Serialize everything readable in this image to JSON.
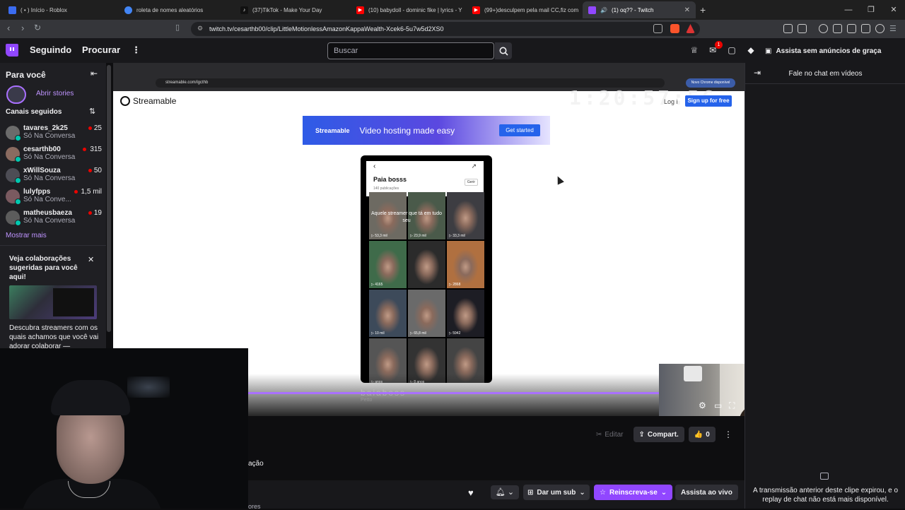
{
  "browser": {
    "tabs": [
      {
        "title": "( • ) Início - Roblox",
        "icon_color": "#3b6cf0"
      },
      {
        "title": "roleta de nomes aleatórios",
        "icon_color": "#4285f4"
      },
      {
        "title": "(37)TikTok - Make Your Day",
        "icon_color": "#111111"
      },
      {
        "title": "(10) babydoll - dominic fike | lyrics - Y",
        "icon_color": "#ff0000"
      },
      {
        "title": "(99+)desculpem pela mail CC,fiz com",
        "icon_color": "#ff0000"
      },
      {
        "title": "(1) oq?? - Twitch",
        "icon_color": "#9147ff",
        "active": true
      }
    ],
    "url": "twitch.tv/cesarthb00/clip/LittleMotionlessAmazonKappaWealth-Xcek6-5u7w5d2XS0"
  },
  "twitch_nav": {
    "following": "Seguindo",
    "browse": "Procurar",
    "search_placeholder": "Buscar",
    "notifications_count": "1",
    "ad_free": "Assista sem anúncios de graça"
  },
  "sidebar": {
    "for_you": "Para você",
    "stories": "Abrir stories",
    "followed_title": "Canais seguidos",
    "channels": [
      {
        "name": "tavares_2k25",
        "game": "Só Na Conversa",
        "viewers": "25",
        "avatar": "#6b6b6b"
      },
      {
        "name": "cesarthb00",
        "game": "Só Na Conversa",
        "viewers": "315",
        "avatar": "#8a6b60"
      },
      {
        "name": "xWillSouza",
        "game": "Só Na Conversa",
        "viewers": "50",
        "avatar": "#4d4d55"
      },
      {
        "name": "lulyfpps",
        "game": "Só Na Conve...",
        "viewers": "1,5 mil",
        "avatar": "#7a5a60"
      },
      {
        "name": "matheusbaeza",
        "game": "Só Na Conversa",
        "viewers": "19",
        "avatar": "#5c5c5c"
      }
    ],
    "show_more": "Mostrar mais",
    "collab_title": "Veja colaborações sugeridas para você aqui!",
    "collab_desc": "Descubra streamers com os quais achamos que você vai adorar colaborar —"
  },
  "player": {
    "inner_url": "streamable.com/lgcthb",
    "inner_update": "Novo Chrome disponível",
    "streamable_brand": "Streamable",
    "timer": "1:20:57:56",
    "login": "Log i",
    "signup": "Sign up for free",
    "banner_brand": "Streamable",
    "banner_text": "Video hosting made easy",
    "banner_cta": "Get started",
    "profile_name": "Paia bosss",
    "profile_posts": "140 publicações",
    "profile_manage": "Gerir",
    "overlay_text": "Aquele streamer que tá em tudo seu",
    "cell_views": [
      "53,3 mil",
      "23,9 mil",
      "33,3 mil",
      "4165",
      "",
      "2868",
      "10 mil",
      "65,8 mil",
      "5942",
      "anos",
      "8 anos",
      ""
    ],
    "ghost_title": "baiaboss",
    "ghost_sub": "Petto",
    "progress": 0.94
  },
  "below": {
    "edit": "Editar",
    "share": "Compart.",
    "likes": "0",
    "text_cut": "ação",
    "text_cut2": "ores",
    "sub": "Dar um sub",
    "follow": "Reinscreva-se",
    "watch_live": "Assista ao vivo"
  },
  "chat": {
    "title": "Fale no chat em vídeos",
    "message": "A transmissão anterior deste clipe expirou, e o replay de chat não está mais disponível."
  }
}
